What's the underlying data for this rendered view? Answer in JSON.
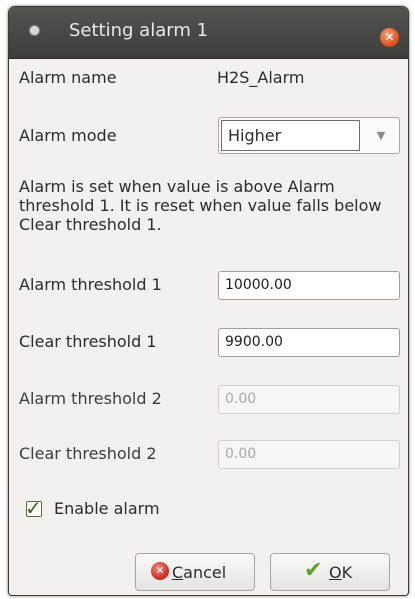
{
  "window": {
    "title": "Setting alarm 1"
  },
  "alarm_name": {
    "label": "Alarm name",
    "value": "H2S_Alarm"
  },
  "alarm_mode": {
    "label": "Alarm mode",
    "value": "Higher"
  },
  "description": "Alarm is set when value is above Alarm threshold 1. It is reset when value falls below Clear threshold 1.",
  "fields": [
    {
      "label": "Alarm threshold 1",
      "value": "10000.00",
      "enabled": true
    },
    {
      "label": "Clear threshold 1",
      "value": "9900.00",
      "enabled": true
    },
    {
      "label": "Alarm threshold 2",
      "value": "0.00",
      "enabled": false
    },
    {
      "label": "Clear threshold 2",
      "value": "0.00",
      "enabled": false
    }
  ],
  "enable_alarm": {
    "label": "Enable alarm",
    "checked": true
  },
  "buttons": {
    "cancel": {
      "mnemonic": "C",
      "rest": "ancel"
    },
    "ok": {
      "mnemonic": "O",
      "rest": "K"
    }
  }
}
